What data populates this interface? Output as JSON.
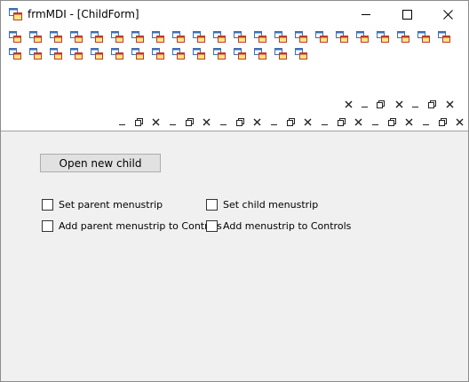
{
  "window": {
    "title": "frmMDI - [ChildForm]"
  },
  "menu": {
    "row1_count": 22,
    "row2_count": 15
  },
  "content": {
    "open_button": "Open new child",
    "checkboxes": {
      "set_parent": "Set parent menustrip",
      "set_child": "Set child menustrip",
      "add_parent": "Add parent menustrip to Controls",
      "add_menustrip": "Add menustrip to Controls"
    }
  }
}
